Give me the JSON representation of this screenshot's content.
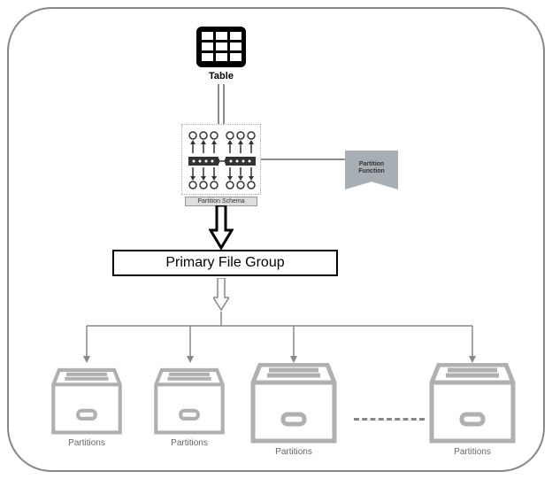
{
  "labels": {
    "table": "Table",
    "partition_schema": "Partition Schema",
    "partition_function_line1": "Partition",
    "partition_function_line2": "Function",
    "primary_file_group": "Primary File Group",
    "partition1": "Partitions",
    "partition2": "Partitions",
    "partition3": "Partitions",
    "partitionN": "Partitions"
  },
  "colors": {
    "stroke": "#888888",
    "drawer": "#b0b0b0",
    "badge": "#a7aeb4",
    "black": "#000000"
  },
  "diagram": {
    "flow": [
      "Table",
      "Partition Schema",
      "Primary File Group",
      "Partitions[]"
    ],
    "side_input": {
      "from": "Partition Function",
      "to": "Partition Schema"
    }
  }
}
